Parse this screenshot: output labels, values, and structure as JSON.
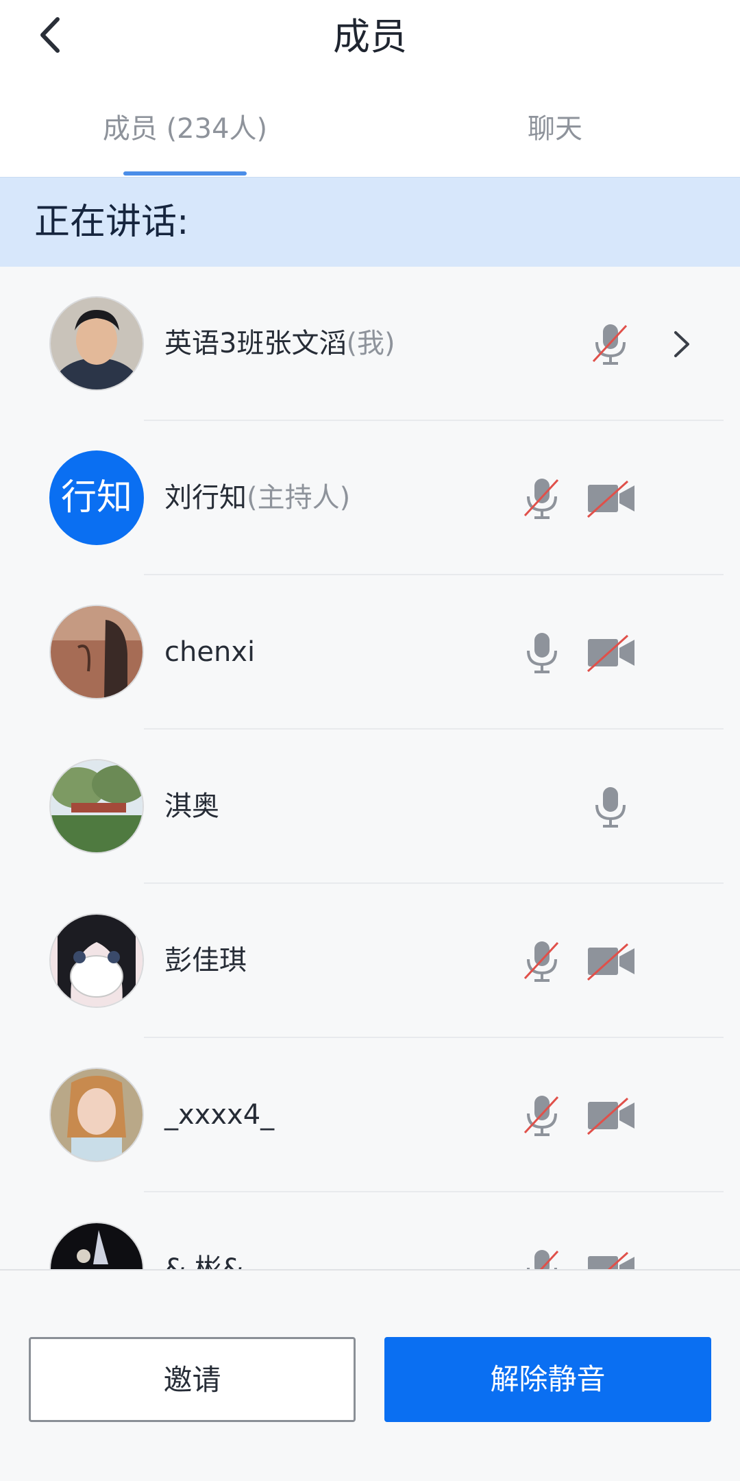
{
  "header": {
    "title": "成员",
    "back_icon": "chevron-left-icon"
  },
  "tabs": [
    {
      "label": "成员 (234人)",
      "active": true
    },
    {
      "label": "聊天",
      "active": false
    }
  ],
  "speaking": {
    "label": "正在讲话:"
  },
  "members": [
    {
      "name": "英语3班张文滔",
      "suffix": "(我)",
      "avatar": "photo",
      "mic": "muted",
      "camera": "none",
      "chevron": true
    },
    {
      "name": "刘行知",
      "suffix": "(主持人)",
      "avatar_text": "行知",
      "mic": "muted",
      "camera": "off"
    },
    {
      "name": "chenxi",
      "suffix": "",
      "avatar": "photo",
      "mic": "on",
      "camera": "off"
    },
    {
      "name": "淇奥",
      "suffix": "",
      "avatar": "photo",
      "mic": "on",
      "camera": "none"
    },
    {
      "name": "  彭佳琪",
      "suffix": "",
      "avatar": "photo",
      "mic": "muted",
      "camera": "off"
    },
    {
      "name": "_xxxx4_",
      "suffix": "",
      "avatar": "photo",
      "mic": "muted",
      "camera": "off"
    },
    {
      "name": "& 彬&",
      "suffix": "",
      "avatar": "photo",
      "mic": "muted",
      "camera": "off"
    }
  ],
  "actions": {
    "invite_label": "邀请",
    "unmute_label": "解除静音"
  },
  "colors": {
    "accent": "#0a6ff2",
    "speaking_bg": "#d7e7fb",
    "muted_slash": "#e0504a",
    "icon_gray": "#8e939b"
  }
}
